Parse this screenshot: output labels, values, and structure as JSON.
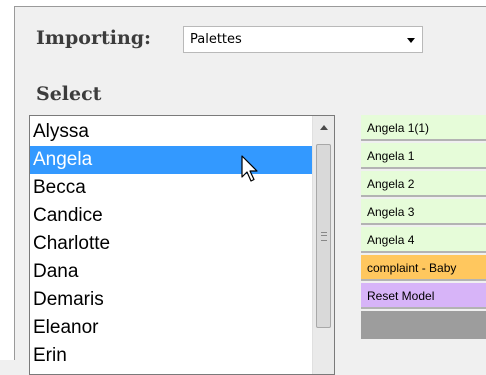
{
  "importing": {
    "label": "Importing:",
    "selected": "Palettes"
  },
  "select": {
    "label": "Select",
    "items": [
      "Alyssa",
      "Angela",
      "Becca",
      "Candice",
      "Charlotte",
      "Dana",
      "Demaris",
      "Eleanor",
      "Erin"
    ],
    "selected_item": "Angela"
  },
  "palette": {
    "buttons": [
      {
        "label": "Angela 1(1)",
        "color": "#e6fcd9"
      },
      {
        "label": "Angela 1",
        "color": "#e6fcd9"
      },
      {
        "label": "Angela 2",
        "color": "#e6fcd9"
      },
      {
        "label": "Angela 3",
        "color": "#e6fcd9"
      },
      {
        "label": "Angela 4",
        "color": "#e6fcd9"
      },
      {
        "label": "complaint - Baby",
        "color": "#ffc75e"
      },
      {
        "label": "Reset Model",
        "color": "#d7b4f8"
      }
    ]
  },
  "colors": {
    "selection": "#3399ff",
    "background": "#f0f0f0"
  },
  "icons": {
    "combo": "chevron-down-icon",
    "scroll_up": "up-arrow-icon",
    "pointer": "mouse-cursor-icon"
  }
}
